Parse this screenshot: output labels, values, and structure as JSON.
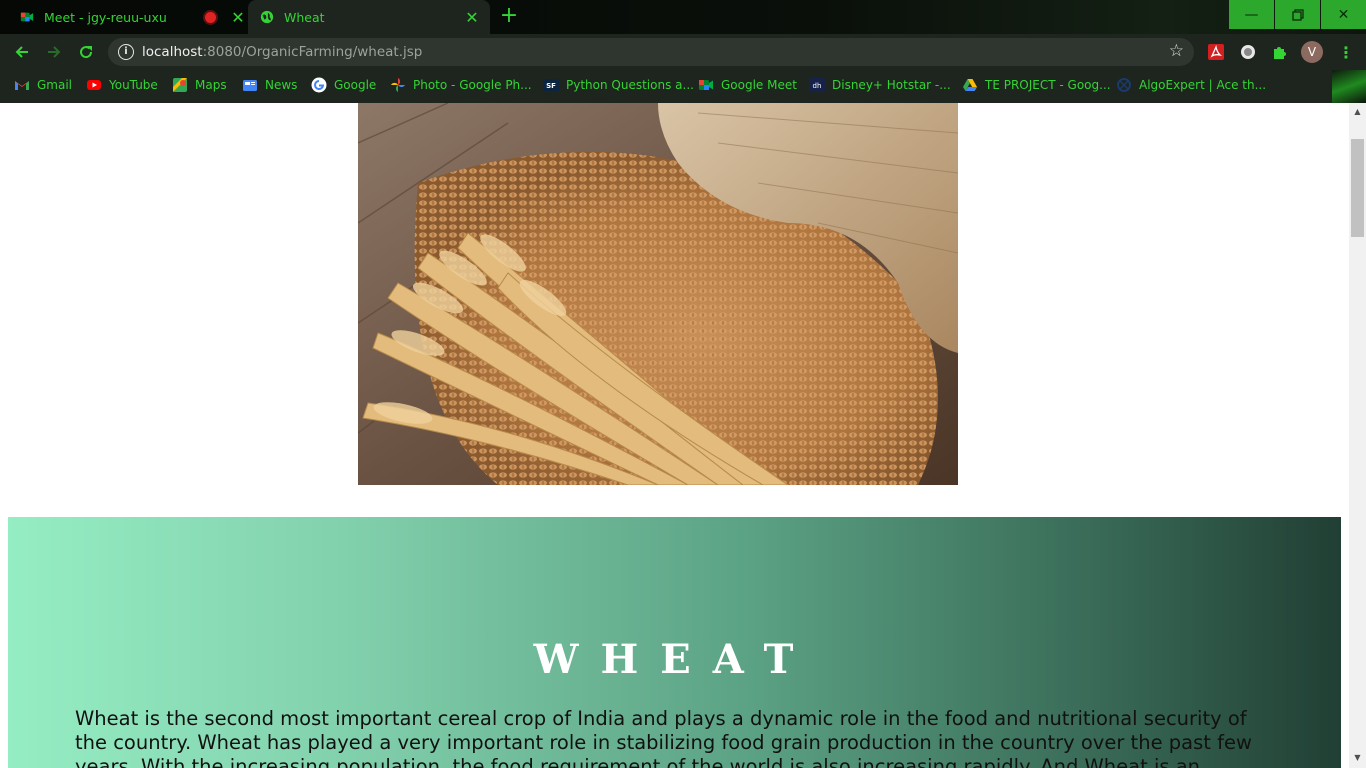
{
  "tabs": [
    {
      "title": "Meet - jgy-reuu-uxu",
      "recording": true
    },
    {
      "title": "Wheat",
      "active": true
    }
  ],
  "toolbar": {
    "url_host": "localhost",
    "url_path": ":8080/OrganicFarming/wheat.jsp",
    "profile_initial": "V"
  },
  "bookmarks": [
    {
      "label": "Gmail",
      "icon": "gmail-icon"
    },
    {
      "label": "YouTube",
      "icon": "youtube-icon"
    },
    {
      "label": "Maps",
      "icon": "maps-icon"
    },
    {
      "label": "News",
      "icon": "news-icon"
    },
    {
      "label": "Google",
      "icon": "google-icon"
    },
    {
      "label": "Photo - Google Ph...",
      "icon": "photos-icon"
    },
    {
      "label": "Python Questions a...",
      "icon": "sf-icon"
    },
    {
      "label": "Google Meet",
      "icon": "meet-icon"
    },
    {
      "label": "Disney+ Hotstar -...",
      "icon": "hotstar-icon"
    },
    {
      "label": "TE PROJECT - Goog...",
      "icon": "drive-icon"
    },
    {
      "label": "AlgoExpert | Ace th...",
      "icon": "algoexpert-icon"
    }
  ],
  "page": {
    "banner_title": "WHEAT",
    "banner_text": "Wheat is the second most important cereal crop of India and plays a dynamic role in the food and nutritional security of the country. Wheat has played a very important role in stabilizing food grain production in the country over the past few years. With the increasing population, the food requirement of the world is also increasing rapidly. And Wheat is an"
  },
  "colors": {
    "chrome_accent": "#35d435",
    "banner_gradient_start": "#95edc3",
    "banner_gradient_end": "#213f34"
  }
}
